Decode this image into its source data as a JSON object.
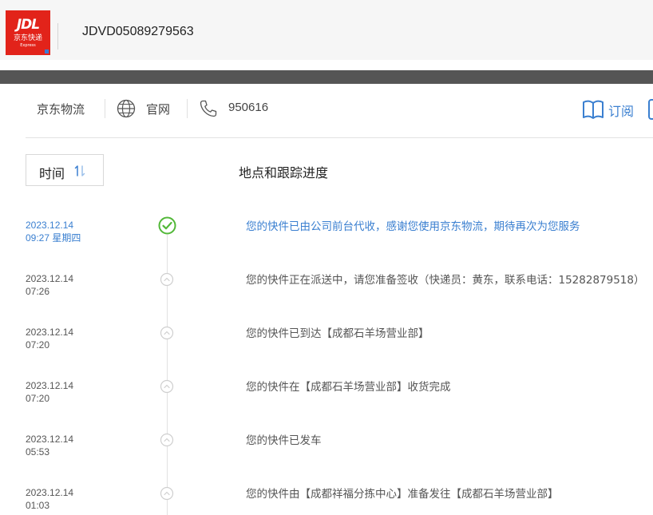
{
  "header": {
    "logo": {
      "brand": "JDL",
      "subtitle": "京东快递",
      "tagline": "Express"
    },
    "tracking_number": "JDVD05089279563"
  },
  "nav": {
    "brand": "京东物流",
    "website": "官网",
    "phone": "950616",
    "subscribe": "订阅"
  },
  "table": {
    "sort_label": "时间",
    "progress_header": "地点和跟踪进度"
  },
  "events": [
    {
      "date": "2023.12.14",
      "time": "09:27 星期四",
      "text": "您的快件已由公司前台代收，感谢您使用京东物流，期待再次为您服务",
      "status": "delivered"
    },
    {
      "date": "2023.12.14",
      "time": "07:26",
      "text": "您的快件正在派送中，请您准备签收（快递员：黄东，联系电话：15282879518）",
      "status": "past"
    },
    {
      "date": "2023.12.14",
      "time": "07:20",
      "text": "您的快件已到达【成都石羊场营业部】",
      "status": "past"
    },
    {
      "date": "2023.12.14",
      "time": "07:20",
      "text": "您的快件在【成都石羊场营业部】收货完成",
      "status": "past"
    },
    {
      "date": "2023.12.14",
      "time": "05:53",
      "text": "您的快件已发车",
      "status": "past"
    },
    {
      "date": "2023.12.14",
      "time": "01:03",
      "text": "您的快件由【成都祥福分拣中心】准备发往【成都石羊场营业部】",
      "status": "past"
    }
  ],
  "colors": {
    "brand_red": "#e2231a",
    "accent_blue": "#3a7fd0",
    "success_green": "#52b838",
    "dark_bar": "#555555"
  }
}
